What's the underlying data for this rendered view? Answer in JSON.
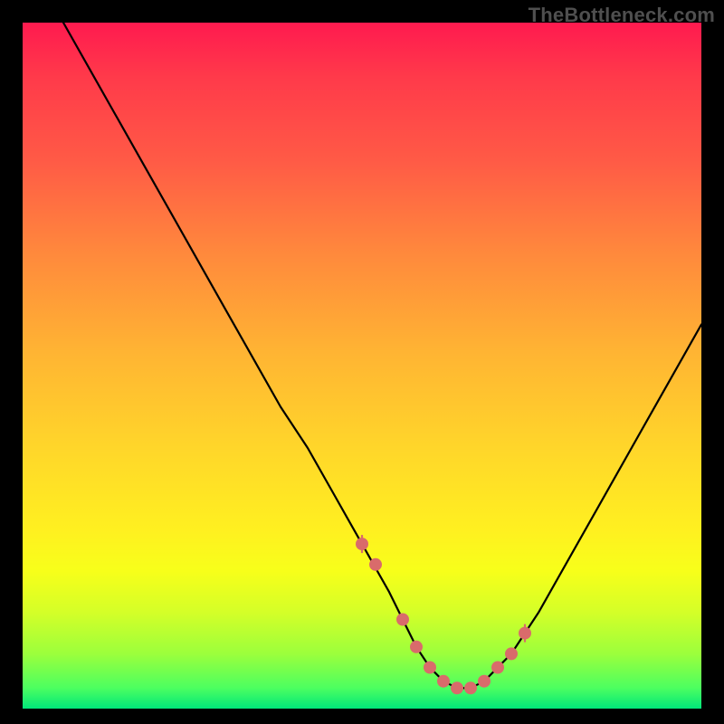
{
  "watermark": "TheBottleneck.com",
  "chart_data": {
    "type": "line",
    "title": "",
    "xlabel": "",
    "ylabel": "",
    "xlim": [
      0,
      100
    ],
    "ylim": [
      0,
      100
    ],
    "series": [
      {
        "name": "curve",
        "x": [
          6,
          10,
          14,
          18,
          22,
          26,
          30,
          34,
          38,
          42,
          46,
          50,
          54,
          56,
          58,
          60,
          62,
          64,
          66,
          68,
          72,
          76,
          80,
          84,
          88,
          92,
          96,
          100
        ],
        "values": [
          100,
          93,
          86,
          79,
          72,
          65,
          58,
          51,
          44,
          38,
          31,
          24,
          17,
          13,
          9,
          6,
          4,
          3,
          3,
          4,
          8,
          14,
          21,
          28,
          35,
          42,
          49,
          56
        ]
      }
    ],
    "markers": {
      "name": "highlight-points",
      "x": [
        50,
        52,
        56,
        58,
        60,
        62,
        64,
        66,
        68,
        70,
        72,
        74
      ],
      "values": [
        24,
        21,
        13,
        9,
        6,
        4,
        3,
        3,
        4,
        6,
        8,
        11
      ]
    },
    "ticks": {
      "x": [
        50,
        74
      ],
      "height": 3
    },
    "colors": {
      "curve": "#000000",
      "markers": "#d96b6b",
      "gradient_top": "#ff1a4f",
      "gradient_bottom": "#00e67a"
    }
  }
}
